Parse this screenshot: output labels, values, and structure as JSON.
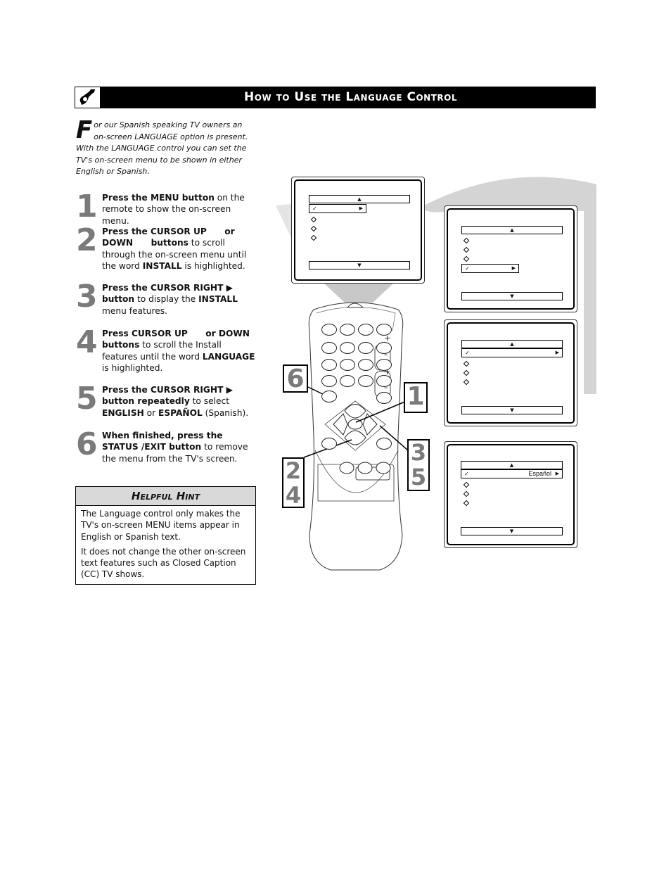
{
  "header": {
    "icon": "wrench-icon",
    "title": "How to Use the Language Control"
  },
  "intro": {
    "dropcap": "F",
    "text": "or our Spanish speaking TV owners an on-screen LANGUAGE option is present. With the LANGUAGE control you can set the TV's on-screen menu to be shown in either English or Spanish."
  },
  "steps": [
    {
      "number": "1",
      "parts": [
        {
          "b": "Press the MENU button"
        },
        {
          "t": " on the remote to show the on-screen menu."
        }
      ]
    },
    {
      "number": "2",
      "parts": [
        {
          "b": "Press the CURSOR UP      or DOWN      buttons"
        },
        {
          "t": " to scroll through the on-screen menu until the word "
        },
        {
          "b": "INSTALL"
        },
        {
          "t": " is highlighted."
        }
      ]
    },
    {
      "number": "3",
      "parts": [
        {
          "b": "Press the CURSOR RIGHT ▶ button"
        },
        {
          "t": " to display the "
        },
        {
          "b": "INSTALL"
        },
        {
          "t": " menu features."
        }
      ]
    },
    {
      "number": "4",
      "parts": [
        {
          "b": "Press CURSOR UP      or DOWN      buttons"
        },
        {
          "t": " to scroll the Install features until the word "
        },
        {
          "b": "LANGUAGE"
        },
        {
          "t": " is highlighted."
        }
      ]
    },
    {
      "number": "5",
      "parts": [
        {
          "b": "Press the CURSOR RIGHT ▶ button repeatedly"
        },
        {
          "t": " to select "
        },
        {
          "b": "ENGLISH"
        },
        {
          "t": " or "
        },
        {
          "b": "ESPAÑOL"
        },
        {
          "t": " (Spanish)."
        }
      ]
    },
    {
      "number": "6",
      "parts": [
        {
          "b": "When finished, press the STATUS /EXIT button"
        },
        {
          "t": " to remove the menu from the TV's screen."
        }
      ]
    }
  ],
  "hint": {
    "title": "Helpful Hint",
    "paragraphs": [
      "The Language control only makes the TV's on-screen MENU items appear in English or Spanish text.",
      "It does not change the other on-screen text features such as Closed Caption (CC) TV shows."
    ]
  },
  "screens": [
    {
      "id": "screen-1",
      "selected_value": ""
    },
    {
      "id": "screen-2",
      "selected_value": ""
    },
    {
      "id": "screen-3",
      "selected_value": ""
    },
    {
      "id": "screen-4",
      "selected_value": "Español"
    }
  ],
  "menu_glyphs": {
    "up": "▲",
    "down": "▼",
    "right": "▶",
    "check": "✓"
  },
  "remote": {
    "plus": "+",
    "minus": "–",
    "callouts": [
      "6",
      "1",
      "3\n5",
      "2\n4"
    ]
  },
  "colors": {
    "header_bg": "#000000",
    "hint_header_bg": "#d9d9d9",
    "step_number": "#7a7a7a",
    "swoosh": "#d4d4d4"
  }
}
